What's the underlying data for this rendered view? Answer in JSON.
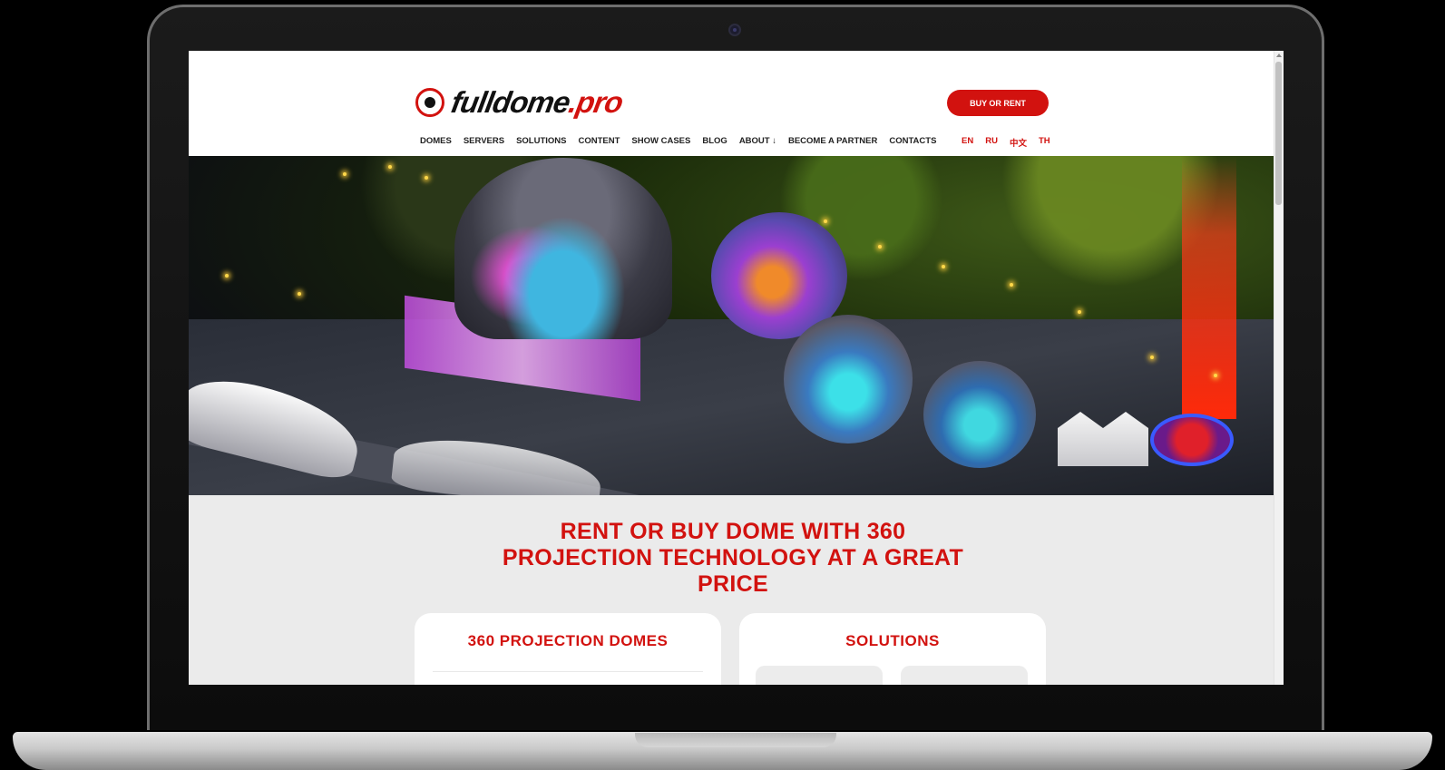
{
  "site": {
    "logo_text": "fulldome",
    "logo_suffix": "pro",
    "logo_dot": "."
  },
  "header": {
    "cta_label": "BUY OR RENT",
    "nav": [
      {
        "label": "DOMES"
      },
      {
        "label": "SERVERS"
      },
      {
        "label": "SOLUTIONS"
      },
      {
        "label": "CONTENT"
      },
      {
        "label": "SHOW CASES"
      },
      {
        "label": "BLOG"
      },
      {
        "label": "ABOUT ↓"
      },
      {
        "label": "BECOME A PARTNER"
      },
      {
        "label": "CONTACTS"
      }
    ],
    "languages": [
      {
        "label": "EN"
      },
      {
        "label": "RU"
      },
      {
        "label": "中文"
      },
      {
        "label": "TH"
      }
    ]
  },
  "hero": {
    "image": "night-dome-festival-photo"
  },
  "main": {
    "headline": "RENT OR BUY DOME WITH 360 PROJECTION TECHNOLOGY AT A GREAT PRICE",
    "cards": [
      {
        "title": "360 PROJECTION DOMES"
      },
      {
        "title": "SOLUTIONS"
      }
    ]
  },
  "colors": {
    "accent": "#d2120f",
    "page_bg": "#ebebeb",
    "header_bg": "#ffffff"
  }
}
